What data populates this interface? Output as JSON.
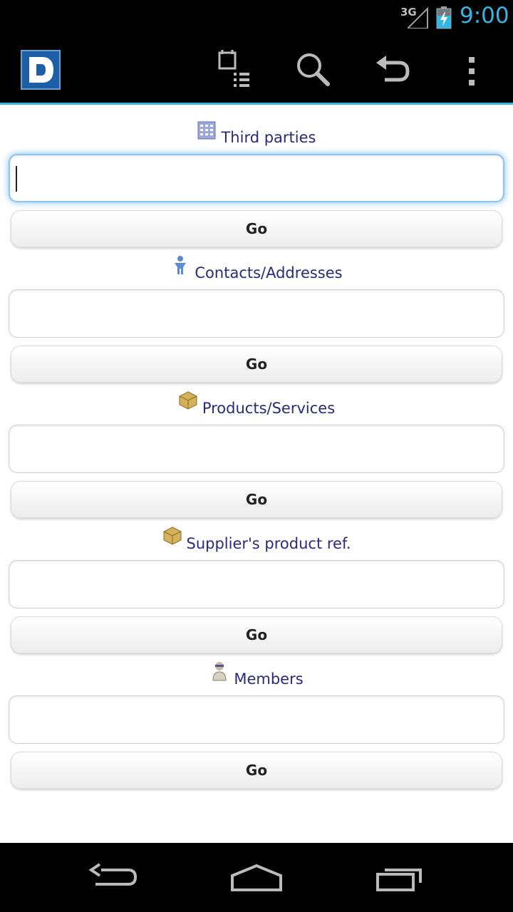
{
  "status_bar": {
    "network": "3G",
    "time": "9:00"
  },
  "action_bar": {
    "logo_letter": "D",
    "icons": [
      "calendar-list-icon",
      "search-icon",
      "undo-icon",
      "overflow-menu-icon"
    ]
  },
  "sections": [
    {
      "label": "Third parties",
      "icon": "building-icon",
      "value": "",
      "button": "Go"
    },
    {
      "label": "Contacts/Addresses",
      "icon": "person-icon",
      "value": "",
      "button": "Go"
    },
    {
      "label": "Products/Services",
      "icon": "box-icon",
      "value": "",
      "button": "Go"
    },
    {
      "label": "Supplier's product ref.",
      "icon": "box-icon",
      "value": "",
      "button": "Go"
    },
    {
      "label": "Members",
      "icon": "member-icon",
      "value": "",
      "button": "Go"
    }
  ],
  "nav_bar": {
    "icons": [
      "back-icon",
      "home-icon",
      "recent-apps-icon"
    ]
  },
  "colors": {
    "accent": "#33b5e5",
    "label_text": "#2a2a7a",
    "bar_background": "#000000"
  }
}
